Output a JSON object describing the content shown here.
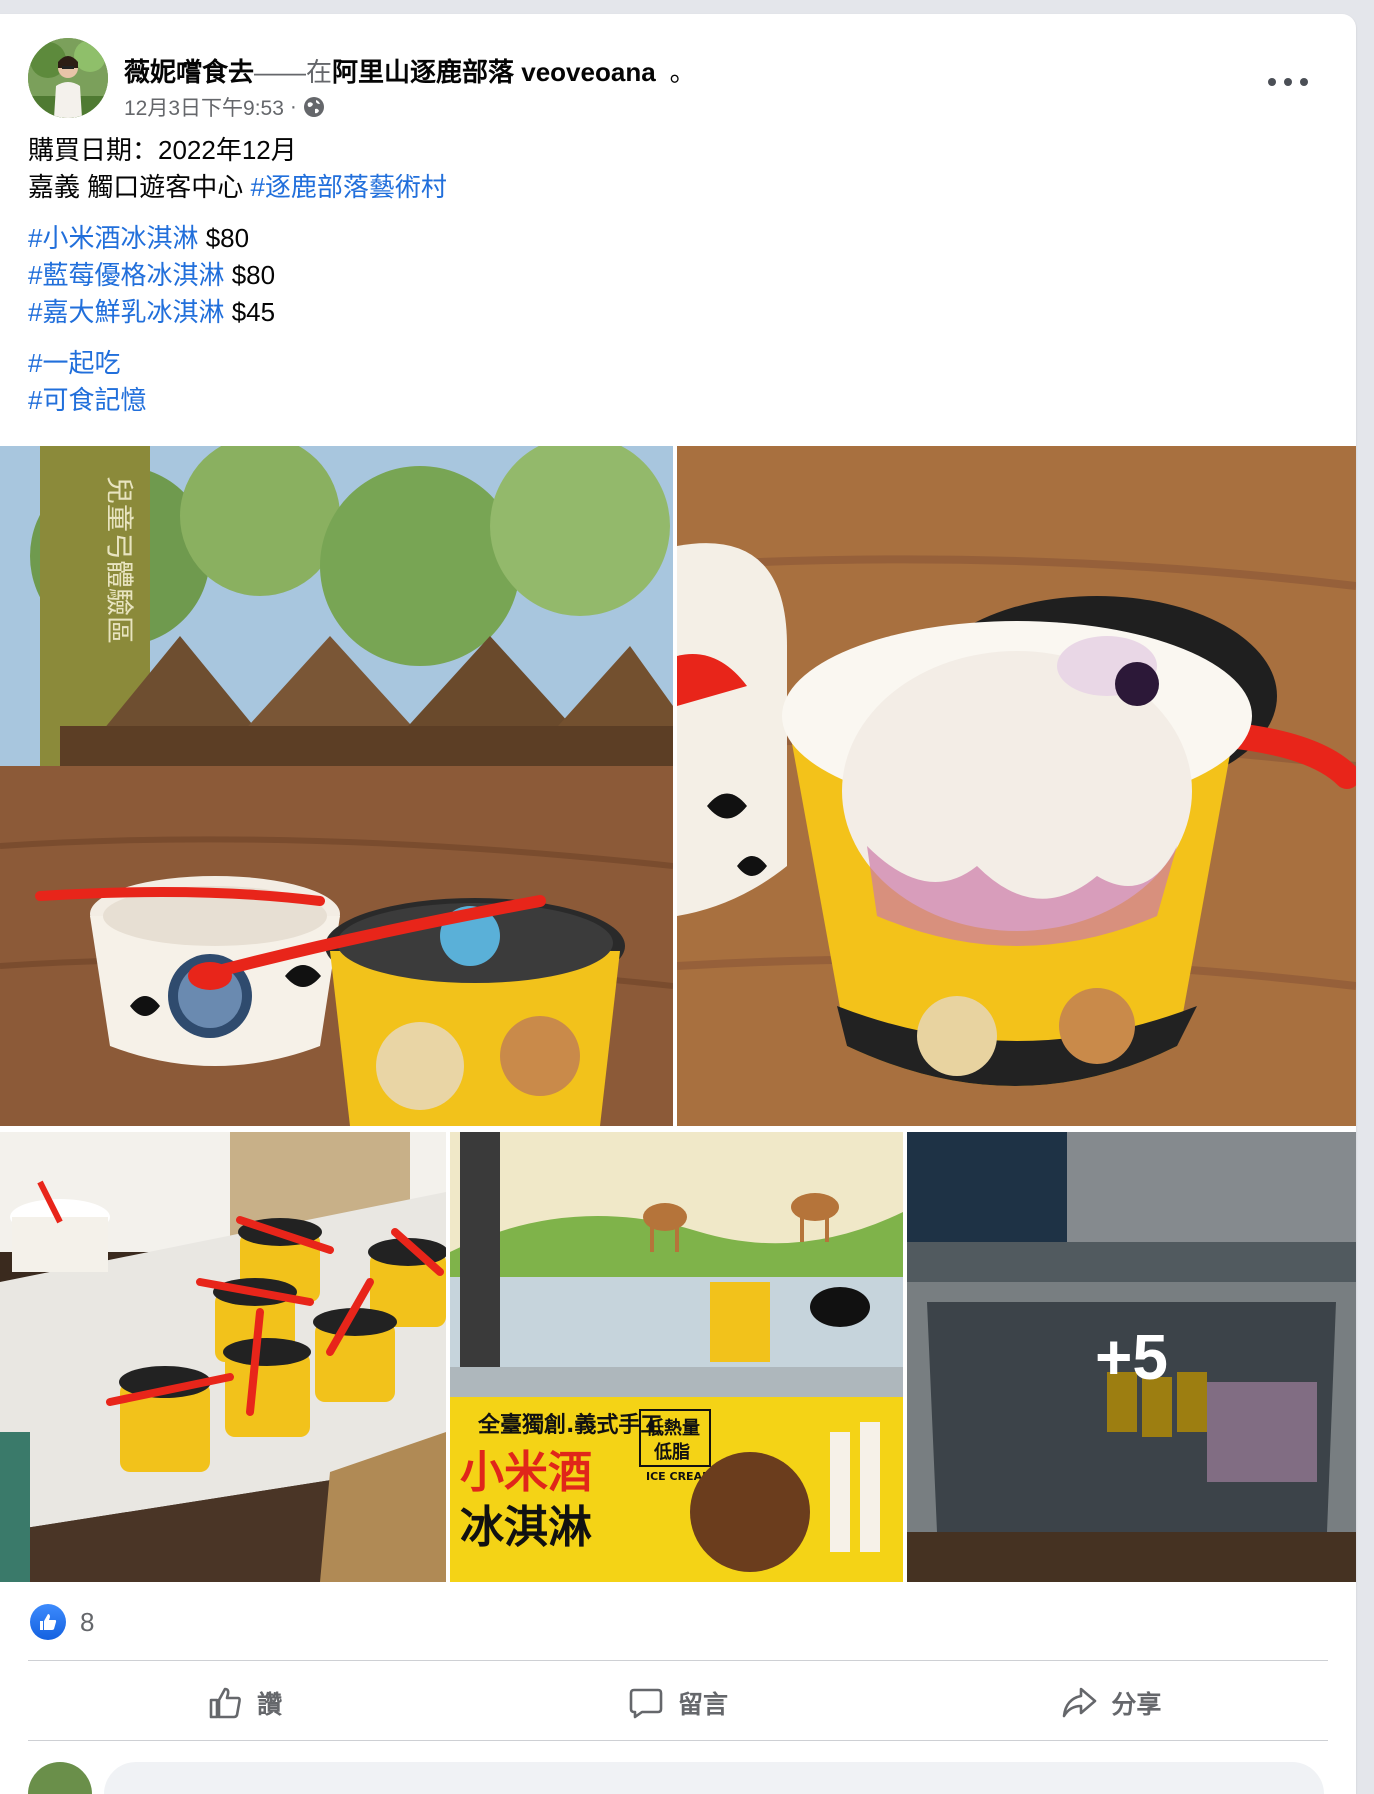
{
  "post": {
    "author": "薇妮嚐食去",
    "dash": "——",
    "at": "在",
    "location": "阿里山逐鹿部落 veoveoana",
    "tail": "。",
    "timestamp": "12月3日下午9:53",
    "sep": "·",
    "privacy_icon": "globe-icon"
  },
  "body": {
    "line1": "購買日期：2022年12月",
    "line2_text": "嘉義 觸口遊客中心 ",
    "line2_tag": "#逐鹿部落藝術村",
    "items": [
      {
        "tag": "#小米酒冰淇淋",
        "price": " $80"
      },
      {
        "tag": "#藍莓優格冰淇淋",
        "price": " $80"
      },
      {
        "tag": "#嘉大鮮乳冰淇淋",
        "price": " $45"
      }
    ],
    "tags_end": [
      "#一起吃",
      "#可食記憶"
    ]
  },
  "photos": {
    "more_count": "+5",
    "banner_line1": "全臺獨創.義式手工",
    "banner_line2": "小米酒",
    "banner_line3": "冰淇淋",
    "banner_badge1": "低熱量",
    "banner_badge2": "低脂",
    "banner_sub": "ICE CREAM",
    "sign_text": "兒童弓體驗區"
  },
  "reactions": {
    "icon": "like-icon",
    "count": "8"
  },
  "actions": {
    "like": "讚",
    "comment": "留言",
    "share": "分享"
  },
  "colors": {
    "link": "#216fdb",
    "secondary": "#65676b",
    "like_blue": "#1877f2"
  }
}
